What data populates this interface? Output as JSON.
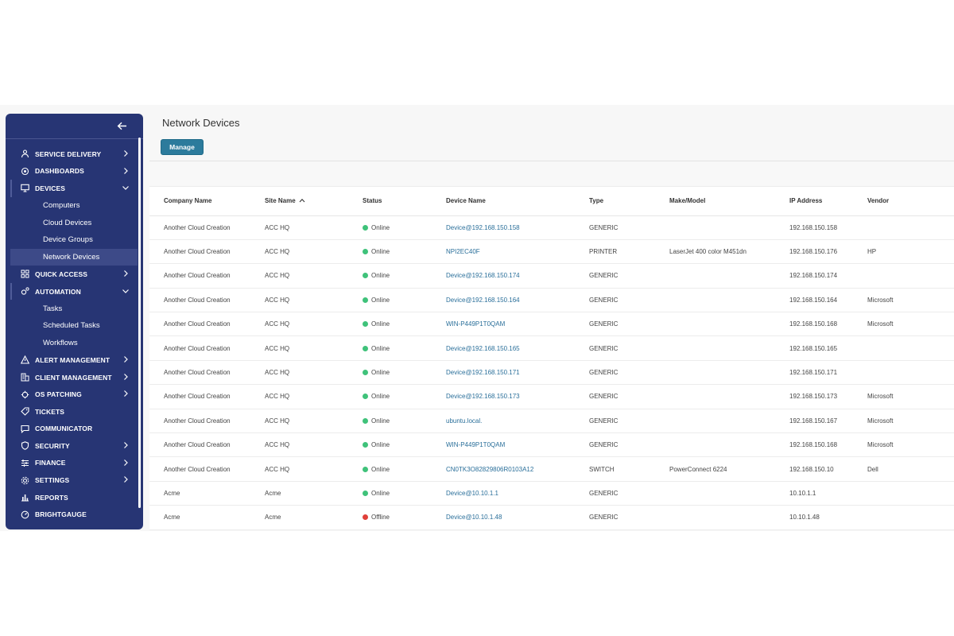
{
  "page": {
    "title": "Network Devices",
    "manage_label": "Manage"
  },
  "colors": {
    "sidebar_bg": "#273574",
    "accent": "#2c7b9c",
    "online": "#3fc27a",
    "offline": "#e0403a",
    "link": "#2a6f9a"
  },
  "sidebar": {
    "back_icon": "arrow-left-icon",
    "items": [
      {
        "label": "SERVICE DELIVERY",
        "icon": "service-delivery-icon",
        "chev": "right"
      },
      {
        "label": "DASHBOARDS",
        "icon": "dashboards-icon",
        "chev": "right"
      },
      {
        "label": "DEVICES",
        "icon": "monitor-icon",
        "chev": "down"
      },
      {
        "label": "Computers",
        "sub": true
      },
      {
        "label": "Cloud Devices",
        "sub": true
      },
      {
        "label": "Device Groups",
        "sub": true
      },
      {
        "label": "Network Devices",
        "sub": true,
        "active": true
      },
      {
        "label": "QUICK ACCESS",
        "icon": "grid-icon",
        "chev": "right"
      },
      {
        "label": "AUTOMATION",
        "icon": "automation-icon",
        "chev": "down"
      },
      {
        "label": "Tasks",
        "sub": true
      },
      {
        "label": "Scheduled Tasks",
        "sub": true
      },
      {
        "label": "Workflows",
        "sub": true
      },
      {
        "label": "ALERT MANAGEMENT",
        "icon": "warning-icon",
        "chev": "right"
      },
      {
        "label": "CLIENT MANAGEMENT",
        "icon": "building-icon",
        "chev": "right"
      },
      {
        "label": "OS PATCHING",
        "icon": "patch-icon",
        "chev": "right"
      },
      {
        "label": "TICKETS",
        "icon": "tag-icon",
        "chev": ""
      },
      {
        "label": "COMMUNICATOR",
        "icon": "chat-icon",
        "chev": ""
      },
      {
        "label": "SECURITY",
        "icon": "shield-icon",
        "chev": "right"
      },
      {
        "label": "FINANCE",
        "icon": "finance-icon",
        "chev": "right"
      },
      {
        "label": "SETTINGS",
        "icon": "gear-icon",
        "chev": "right"
      },
      {
        "label": "REPORTS",
        "icon": "reports-icon",
        "chev": ""
      },
      {
        "label": "BRIGHTGAUGE",
        "icon": "gauge-icon",
        "chev": ""
      }
    ]
  },
  "table": {
    "columns": [
      "Company Name",
      "Site Name",
      "Status",
      "Device Name",
      "Type",
      "Make/Model",
      "IP Address",
      "Vendor"
    ],
    "sort_column": "Site Name",
    "rows": [
      [
        "Another Cloud Creation",
        "ACC HQ",
        "Online",
        "Device@192.168.150.158",
        "GENERIC",
        "",
        "192.168.150.158",
        ""
      ],
      [
        "Another Cloud Creation",
        "ACC HQ",
        "Online",
        "NPI2EC40F",
        "PRINTER",
        "LaserJet 400 color M451dn",
        "192.168.150.176",
        "HP"
      ],
      [
        "Another Cloud Creation",
        "ACC HQ",
        "Online",
        "Device@192.168.150.174",
        "GENERIC",
        "",
        "192.168.150.174",
        ""
      ],
      [
        "Another Cloud Creation",
        "ACC HQ",
        "Online",
        "Device@192.168.150.164",
        "GENERIC",
        "",
        "192.168.150.164",
        "Microsoft"
      ],
      [
        "Another Cloud Creation",
        "ACC HQ",
        "Online",
        "WIN-P449P1T0QAM",
        "GENERIC",
        "",
        "192.168.150.168",
        "Microsoft"
      ],
      [
        "Another Cloud Creation",
        "ACC HQ",
        "Online",
        "Device@192.168.150.165",
        "GENERIC",
        "",
        "192.168.150.165",
        ""
      ],
      [
        "Another Cloud Creation",
        "ACC HQ",
        "Online",
        "Device@192.168.150.171",
        "GENERIC",
        "",
        "192.168.150.171",
        ""
      ],
      [
        "Another Cloud Creation",
        "ACC HQ",
        "Online",
        "Device@192.168.150.173",
        "GENERIC",
        "",
        "192.168.150.173",
        "Microsoft"
      ],
      [
        "Another Cloud Creation",
        "ACC HQ",
        "Online",
        "ubuntu.local.",
        "GENERIC",
        "",
        "192.168.150.167",
        "Microsoft"
      ],
      [
        "Another Cloud Creation",
        "ACC HQ",
        "Online",
        "WIN-P449P1T0QAM",
        "GENERIC",
        "",
        "192.168.150.168",
        "Microsoft"
      ],
      [
        "Another Cloud Creation",
        "ACC HQ",
        "Online",
        "CN0TK3O82829806R0103A12",
        "SWITCH",
        "PowerConnect 6224",
        "192.168.150.10",
        "Dell"
      ],
      [
        "Acme",
        "Acme",
        "Online",
        "Device@10.10.1.1",
        "GENERIC",
        "",
        "10.10.1.1",
        ""
      ],
      [
        "Acme",
        "Acme",
        "Offline",
        "Device@10.10.1.48",
        "GENERIC",
        "",
        "10.10.1.48",
        ""
      ]
    ]
  }
}
